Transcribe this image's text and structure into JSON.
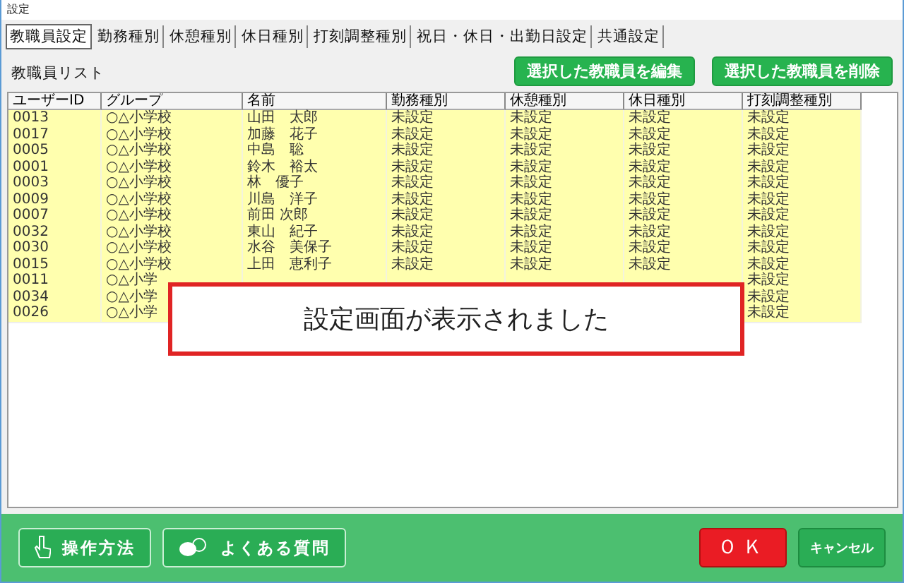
{
  "window": {
    "title": "設定"
  },
  "tabs": [
    {
      "label": "教職員設定",
      "selected": true
    },
    {
      "label": "勤務種別",
      "selected": false
    },
    {
      "label": "休憩種別",
      "selected": false
    },
    {
      "label": "休日種別",
      "selected": false
    },
    {
      "label": "打刻調整種別",
      "selected": false
    },
    {
      "label": "祝日・休日・出勤日設定",
      "selected": false
    },
    {
      "label": "共通設定",
      "selected": false
    }
  ],
  "list_title": "教職員リスト",
  "actions": [
    "選択した教職員を編集",
    "選択した教職員を削除"
  ],
  "table": {
    "columns": [
      "ユーザーID",
      "グループ",
      "名前",
      "勤務種別",
      "休憩種別",
      "休日種別",
      "打刻調整種別"
    ],
    "rows": [
      [
        "0013",
        "○△小学校",
        "山田　太郎",
        "未設定",
        "未設定",
        "未設定",
        "未設定"
      ],
      [
        "0017",
        "○△小学校",
        "加藤　花子",
        "未設定",
        "未設定",
        "未設定",
        "未設定"
      ],
      [
        "0005",
        "○△小学校",
        "中島　聡",
        "未設定",
        "未設定",
        "未設定",
        "未設定"
      ],
      [
        "0001",
        "○△小学校",
        "鈴木　裕太",
        "未設定",
        "未設定",
        "未設定",
        "未設定"
      ],
      [
        "0003",
        "○△小学校",
        "林　優子",
        "未設定",
        "未設定",
        "未設定",
        "未設定"
      ],
      [
        "0009",
        "○△小学校",
        "川島　洋子",
        "未設定",
        "未設定",
        "未設定",
        "未設定"
      ],
      [
        "0007",
        "○△小学校",
        "前田 次郎",
        "未設定",
        "未設定",
        "未設定",
        "未設定"
      ],
      [
        "0032",
        "○△小学校",
        "東山　紀子",
        "未設定",
        "未設定",
        "未設定",
        "未設定"
      ],
      [
        "0030",
        "○△小学校",
        "水谷　美保子",
        "未設定",
        "未設定",
        "未設定",
        "未設定"
      ],
      [
        "0015",
        "○△小学校",
        "上田　恵利子",
        "未設定",
        "未設定",
        "未設定",
        "未設定"
      ],
      [
        "0011",
        "○△小学",
        null,
        null,
        null,
        null,
        "未設定"
      ],
      [
        "0034",
        "○△小学",
        null,
        null,
        null,
        null,
        "未設定"
      ],
      [
        "0026",
        "○△小学",
        null,
        null,
        null,
        null,
        "未設定"
      ]
    ]
  },
  "message": "設定画面が表示されました",
  "footer": {
    "help_buttons": [
      {
        "label": "操作方法",
        "kind": "hand"
      },
      {
        "label": "よくある質問",
        "kind": "qa"
      }
    ],
    "ok": "ＯＫ",
    "cancel": "キャンセル"
  }
}
